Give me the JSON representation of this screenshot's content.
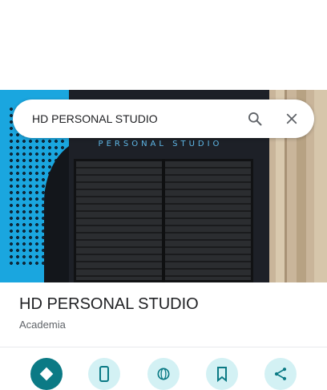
{
  "search": {
    "query": "HD PERSONAL STUDIO"
  },
  "hero": {
    "signage_text": "PERSONAL STUDIO"
  },
  "place": {
    "name": "HD PERSONAL STUDIO",
    "category": "Academia"
  },
  "actions": [
    {
      "icon": "directions-icon"
    },
    {
      "icon": "phone-icon"
    },
    {
      "icon": "website-icon"
    },
    {
      "icon": "save-icon"
    },
    {
      "icon": "share-icon"
    }
  ],
  "colors": {
    "primary_action": "#0b7a85",
    "secondary_action": "#d3f1f4",
    "icon_teal": "#0b7a85"
  }
}
